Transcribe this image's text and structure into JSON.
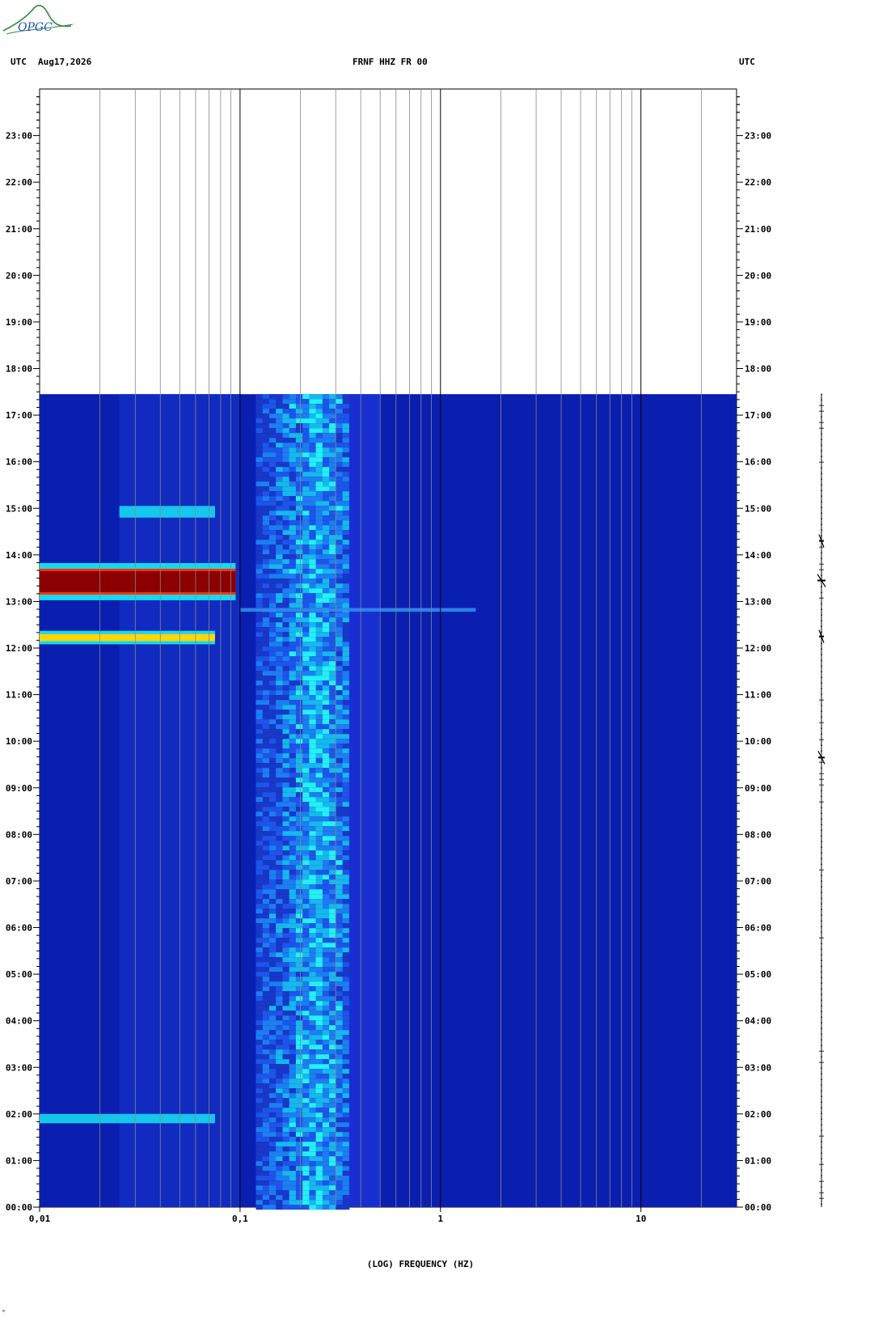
{
  "header": {
    "left_tz": "UTC",
    "date": "Aug17,2026",
    "station": "FRNF HHZ FR 00",
    "right_tz": "UTC"
  },
  "logo": {
    "text": "OPGC"
  },
  "chart_data": {
    "type": "heatmap",
    "title": "FRNF HHZ FR 00",
    "xlabel": "(LOG) FREQUENCY (HZ)",
    "xscale": "log",
    "xlim": [
      0.01,
      30
    ],
    "x_tick_labels": [
      {
        "value": 0.01,
        "label": "0,01"
      },
      {
        "value": 0.1,
        "label": "0,1"
      },
      {
        "value": 1,
        "label": "1"
      },
      {
        "value": 10,
        "label": "10"
      }
    ],
    "ylabel": "UTC",
    "ylim_hours": [
      0,
      24
    ],
    "y_tick_labels": [
      "00:00",
      "01:00",
      "02:00",
      "03:00",
      "04:00",
      "05:00",
      "06:00",
      "07:00",
      "08:00",
      "09:00",
      "10:00",
      "11:00",
      "12:00",
      "13:00",
      "14:00",
      "15:00",
      "16:00",
      "17:00",
      "18:00",
      "19:00",
      "20:00",
      "21:00",
      "22:00",
      "23:00"
    ],
    "data_end_hour": 17.45,
    "features": [
      {
        "freq_range_hz": [
          0.12,
          0.35
        ],
        "time_range_hours": [
          0,
          17.45
        ],
        "level": "medium",
        "note": "microseism band"
      },
      {
        "freq_range_hz": [
          0.01,
          0.095
        ],
        "time_range_hours": [
          13.2,
          13.65
        ],
        "level": "very high"
      },
      {
        "freq_range_hz": [
          0.01,
          0.075
        ],
        "time_range_hours": [
          12.15,
          12.3
        ],
        "level": "high"
      },
      {
        "freq_range_hz": [
          0.025,
          0.075
        ],
        "time_range_hours": [
          14.8,
          15.05
        ],
        "level": "medium"
      },
      {
        "freq_range_hz": [
          0.01,
          0.075
        ],
        "time_range_hours": [
          1.8,
          2.0
        ],
        "level": "medium"
      },
      {
        "freq_range_hz": [
          0.1,
          1.5
        ],
        "time_range_hours": [
          12.78,
          12.86
        ],
        "level": "low-medium"
      }
    ],
    "colors": {
      "background": "#0a1fb0",
      "low": "#1a3ae0",
      "medium": "#16d8f0",
      "high": "#ffd700",
      "very_high": "#8b0000"
    },
    "grid": true
  }
}
